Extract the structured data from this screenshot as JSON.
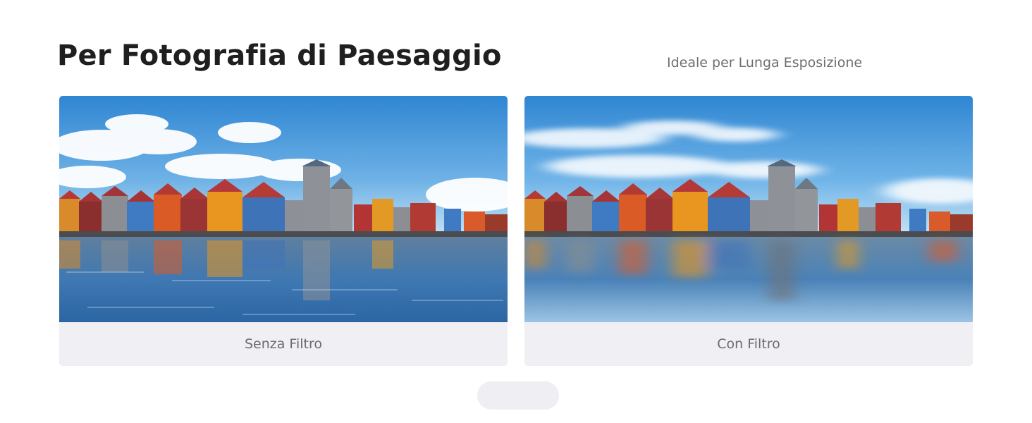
{
  "header": {
    "title": "Per Fotografia di Paesaggio",
    "subtitle": "Ideale per Lunga Esposizione"
  },
  "comparison": {
    "left": {
      "caption": "Senza Filtro",
      "image": "colorful waterfront houses with reflection in lake, sharp water"
    },
    "right": {
      "caption": "Con Filtro",
      "image": "colorful waterfront houses, long exposure with smooth blurred water and clouds"
    }
  },
  "colors": {
    "sky_top": "#3a8fd6",
    "water": "#2f6ea8",
    "caption_bg": "#f0eff3",
    "title_text": "#1f1f1f"
  }
}
